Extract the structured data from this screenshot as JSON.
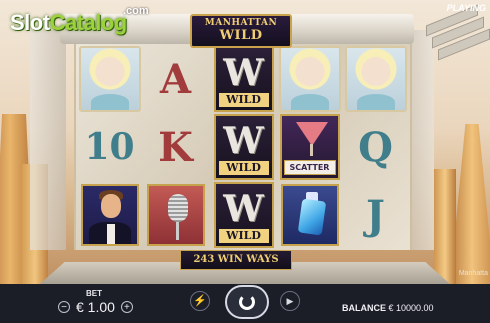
{
  "logo": {
    "part1": "Slot",
    "part2": "Catalog",
    "suffix": ".com"
  },
  "status": "PLAYING",
  "game_title": {
    "line1": "MANHATTAN",
    "line2": "WILD"
  },
  "reels": [
    [
      "portrait",
      "portrait",
      "man"
    ],
    [
      "A",
      "K",
      "mic"
    ],
    [
      "wild",
      "wild",
      "wild"
    ],
    [
      "portrait",
      "scatter",
      "perfume"
    ],
    [
      "portrait",
      "Q",
      "J"
    ]
  ],
  "symbols": {
    "wild_label": "WILD",
    "wild_letter": "W",
    "scatter_label": "SCATTER"
  },
  "letters": {
    "ten": "10",
    "a": "A",
    "k": "K",
    "q": "Q",
    "j": "J"
  },
  "win_ways": "243 WIN WAYS",
  "watermark": "Manhatta",
  "controls": {
    "bet_label": "BET",
    "bet_value": "€ 1.00",
    "minus": "−",
    "plus": "+",
    "balance_label": "BALANCE",
    "balance_value": "€ 10000.00"
  },
  "colors": {
    "gold": "#c7a24d",
    "wild_bg": "#2b2038",
    "bar_bg": "#1b1d27"
  }
}
